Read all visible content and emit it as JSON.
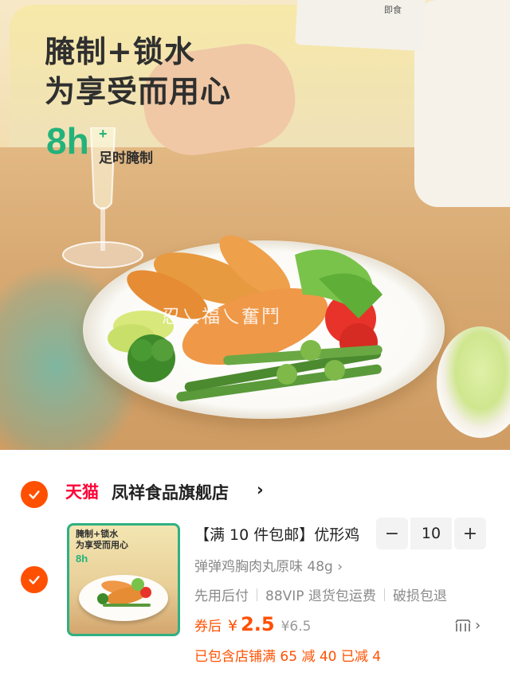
{
  "hero": {
    "title_line1": "腌制+锁水",
    "title_line2": "为享受而用心",
    "hours": "8h",
    "hours_plus": "+",
    "hours_sub": "足时腌制",
    "box_label": "即食",
    "watermark": "忍乀福乀奮鬥"
  },
  "store": {
    "platform": "天猫",
    "name": "凤祥食品旗舰店",
    "chevron": "›"
  },
  "product": {
    "thumb_line1": "腌制+锁水",
    "thumb_line2": "为享受而用心",
    "thumb_hours": "8h",
    "title": "【满 10 件包邮】优形鸡",
    "sku": "弹弹鸡胸肉丸原味 48g ›",
    "services": [
      "先用后付",
      "88VIP 退货包运费",
      "破损包退"
    ],
    "price_label": "券后",
    "currency": "¥",
    "price": "2.5",
    "original_price": "¥6.5",
    "promo": "已包含店铺满 65 减 40 已减 4",
    "more_chevron": "›"
  },
  "stepper": {
    "minus": "−",
    "quantity": "10",
    "plus": "+"
  },
  "colors": {
    "accent": "#ff5000",
    "tmall": "#ff0036",
    "green": "#23b27a"
  }
}
